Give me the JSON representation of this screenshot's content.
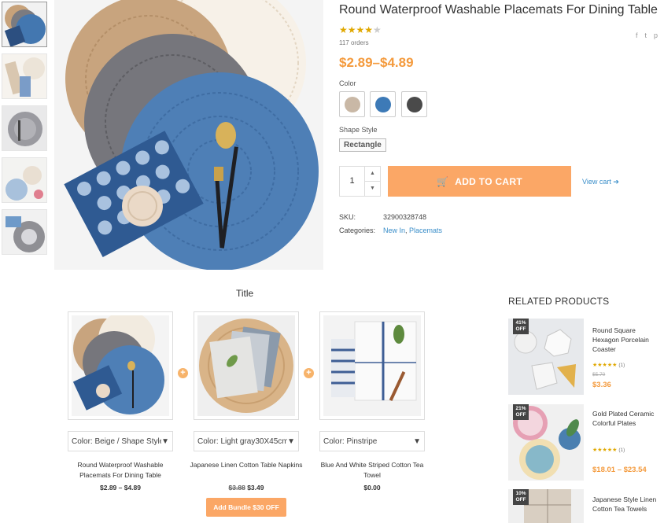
{
  "product": {
    "title": "Round Waterproof Washable Placemats For Dining Table",
    "rating_stars": "★★★★★",
    "orders": "117 orders",
    "price": "$2.89–$4.89",
    "color_label": "Color",
    "colors": [
      "#c9b8a6",
      "#3d7ab7",
      "#4a4a4a"
    ],
    "shape_label": "Shape Style",
    "shape_value": "Rectangle",
    "quantity": "1",
    "add_to_cart": "ADD TO CART",
    "view_cart": "View cart",
    "sku_label": "SKU:",
    "sku_value": "32900328748",
    "categories_label": "Categories:",
    "category_1": "New In",
    "category_2": "Placemats",
    "share_icons": [
      "f",
      "t",
      "p"
    ]
  },
  "bundle": {
    "title": "Title",
    "items": [
      {
        "select": "Color: Beige / Shape Style: Rectangle",
        "name": "Round Waterproof Washable Placemats For Dining Table",
        "price": "$2.89 – $4.89"
      },
      {
        "select": "Color: Light gray30X45cm",
        "name": "Japanese Linen Cotton Table Napkins",
        "old_price": "$3.88",
        "price": "$3.49"
      },
      {
        "select": "Color: Pinstripe",
        "name": "Blue And White Striped Cotton Tea Towel",
        "price": "$0.00"
      }
    ],
    "button": "Add Bundle $30 OFF"
  },
  "related": {
    "title": "RELATED PRODUCTS",
    "items": [
      {
        "badge_pct": "41%",
        "badge_off": "OFF",
        "name": "Round Square Hexagon Porcelain Coaster",
        "stars": "★★★★★",
        "count": "(1)",
        "old_price": "$5.70",
        "price": "$3.36"
      },
      {
        "badge_pct": "21%",
        "badge_off": "OFF",
        "name": "Gold Plated Ceramic Colorful Plates",
        "stars": "★★★★★",
        "count": "(1)",
        "price": "$18.01 – $23.54"
      },
      {
        "badge_pct": "10%",
        "badge_off": "OFF",
        "name": "Japanese Style Linen Cotton Tea Towels"
      }
    ]
  }
}
